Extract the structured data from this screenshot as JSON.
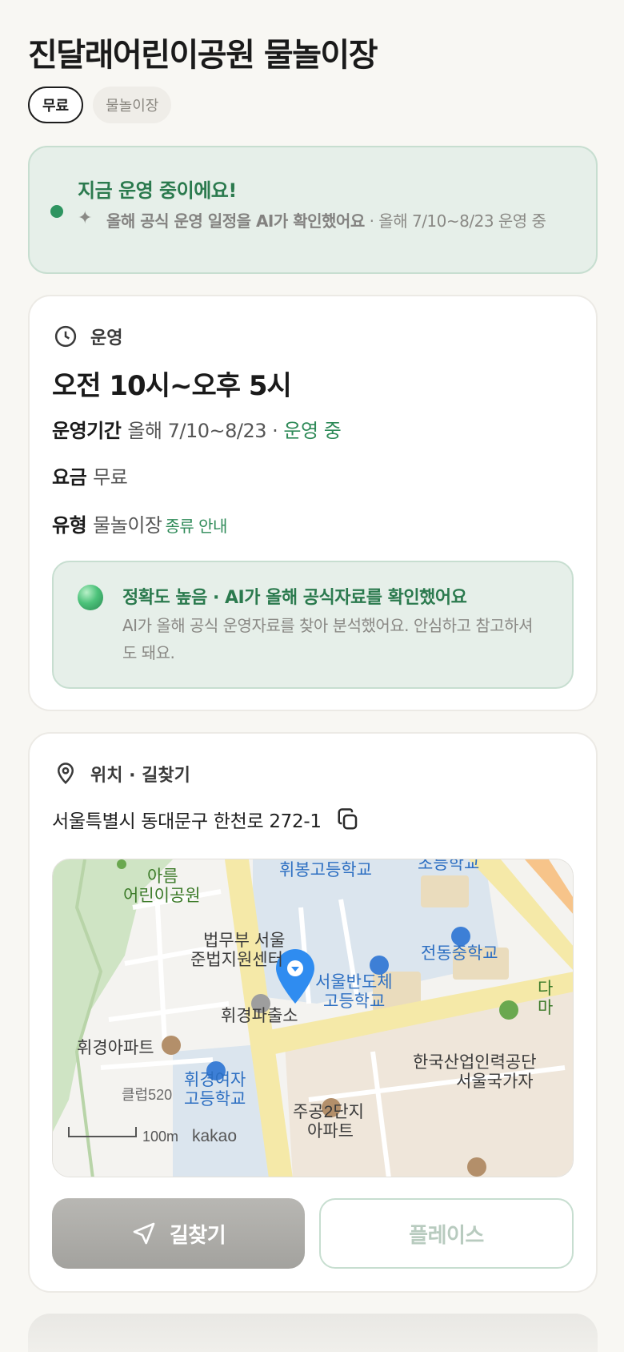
{
  "place": {
    "title": "진달래어린이공원 물놀이장",
    "tags": {
      "fee": "무료",
      "type": "물놀이장"
    }
  },
  "status": {
    "title": "지금 운영 중이에요!",
    "desc_strong": "올해 공식 운영 일정을 AI가 확인했어요",
    "desc_rest": " · 올해 7/10~8/23 운영 중"
  },
  "hours": {
    "section_label": "운영",
    "time": "오전 10시~오후 5시",
    "period_label": "운영기간",
    "period_value": "올해 7/10~8/23 · ",
    "period_status": "운영 중",
    "fee_label": "요금",
    "fee_value": "무료",
    "type_label": "유형",
    "type_value": "물놀이장",
    "type_link": "종류 안내",
    "accuracy_title": "정확도 높음 · AI가 올해 공식자료를 확인했어요",
    "accuracy_desc": "AI가 올해 공식 운영자료를 찾아 분석했어요. 안심하고 참고하셔도 돼요."
  },
  "location": {
    "section_label": "위치 · 길찾기",
    "address": "서울특별시 동대문구 한천로 272-1",
    "map": {
      "labels": {
        "park": "아름",
        "park2": "어린이공원",
        "school1": "휘봉고등학교",
        "school_top": "초등학교",
        "court1": "법무부 서울",
        "court2": "준법지원센터",
        "school2": "전동중학교",
        "semi1": "서울반도체",
        "semi2": "고등학교",
        "police": "휘경파출소",
        "apt1": "휘경아파트",
        "girls1": "휘경여자",
        "girls2": "고등학교",
        "club": "클럽520",
        "apt2a": "주공2단지",
        "apt2b": "아파트",
        "hrd1": "한국산업인력공단",
        "hrd2": "서울국가자",
        "right1": "다",
        "right2": "마",
        "scale": "100m",
        "brand": "kakao"
      }
    },
    "directions_button": "길찾기",
    "place_button": "플레이스"
  },
  "colors": {
    "accent_green": "#2e8a58",
    "status_bg": "#e6efe9",
    "map_pin": "#2f8cf0"
  },
  "icons": {
    "clock": "clock-icon",
    "pin": "location-pin-icon",
    "copy": "copy-icon",
    "navigate": "navigate-arrow-icon",
    "sparkle": "sparkle-icon"
  }
}
